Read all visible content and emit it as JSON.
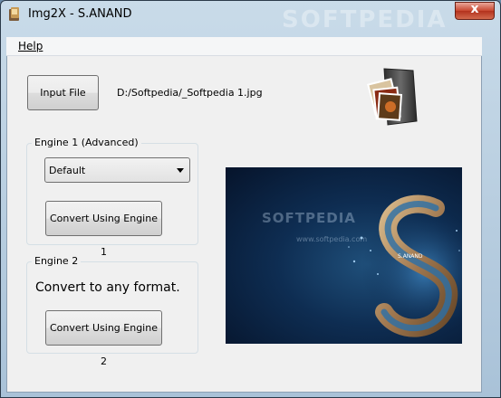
{
  "window": {
    "title": "Img2X - S.ANAND",
    "watermark": "SOFTPEDIA",
    "close_label": "x"
  },
  "menu": {
    "help_first": "H",
    "help_rest": "elp"
  },
  "input": {
    "button_label": "Input File",
    "path": "D:/Softpedia/_Softpedia 1.jpg"
  },
  "engine1": {
    "title": "Engine 1 (Advanced)",
    "selected": "Default",
    "button_label": "Convert Using Engine 1"
  },
  "engine2": {
    "title": "Engine 2",
    "description": "Convert to any format.",
    "button_label": "Convert Using Engine 2"
  },
  "preview": {
    "watermark": "SOFTPEDIA",
    "url": "www.softpedia.com",
    "logo_text": "S.ANAND"
  },
  "colors": {
    "preview_bg": "#0e2d52",
    "close_button": "#c8462f"
  }
}
